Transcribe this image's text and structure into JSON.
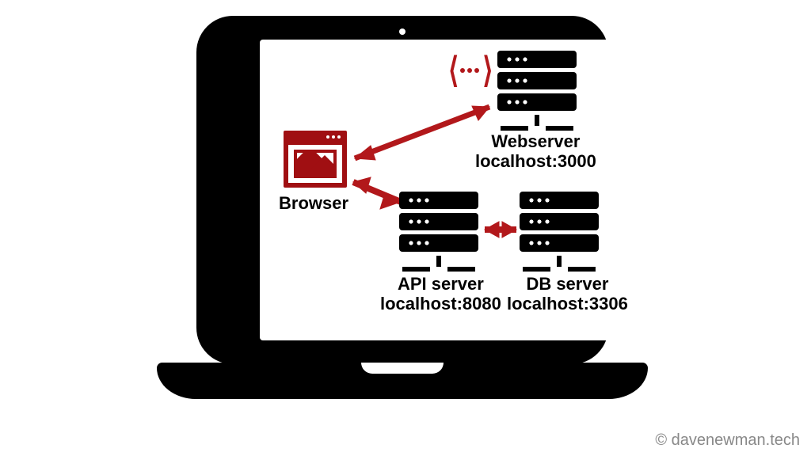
{
  "credit": "© davenewman.tech",
  "nodes": {
    "browser": {
      "label": "Browser"
    },
    "webserver": {
      "title": "Webserver",
      "address": "localhost:3000"
    },
    "apiserver": {
      "title": "API server",
      "address": "localhost:8080"
    },
    "dbserver": {
      "title": "DB server",
      "address": "localhost:3306"
    }
  },
  "colors": {
    "accent": "#a00f12",
    "arrow": "#b2181b",
    "ink": "#000000"
  }
}
